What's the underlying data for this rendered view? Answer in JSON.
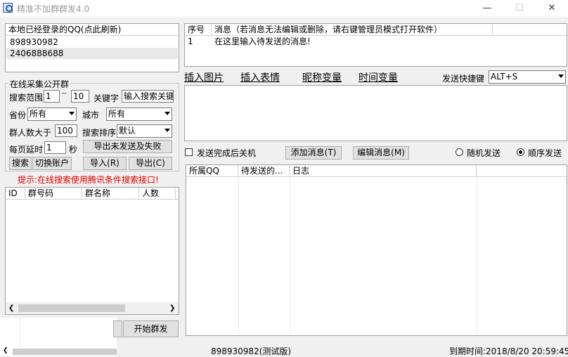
{
  "window": {
    "title": "精准不加群群发4.0",
    "minimize": "—",
    "maximize": "☐",
    "close": "✕"
  },
  "qq_list": {
    "header": "本地已经登录的QQ(点此刷新)",
    "items": [
      "898930982",
      "2406888688"
    ]
  },
  "collect": {
    "group_title": "在线采集公开群",
    "range_label": "搜索范围",
    "range_from": "1",
    "range_sep": "--",
    "range_to": "10",
    "keyword_label": "关键字",
    "keyword_placeholder": "输入搜索关键",
    "province_label": "省份",
    "province_value": "所有",
    "city_label": "城市",
    "city_value": "所有",
    "members_label": "群人数大于",
    "members_value": "100",
    "sort_label": "搜索排序",
    "sort_value": "默认",
    "delay_label": "每页延时",
    "delay_value": "1",
    "delay_unit": "秒",
    "export_unsent_btn": "导出未发送及失败",
    "search_btn": "搜索",
    "switch_btn": "切换账户",
    "import_btn": "导入(R)",
    "export_btn": "导出(C)",
    "hint": "提示:在线搜索使用腾讯条件搜索接口!"
  },
  "group_table": {
    "columns": [
      "ID",
      "群号码",
      "群名称",
      "人数"
    ]
  },
  "bottom_left": {
    "start_btn": "开始群发"
  },
  "messages": {
    "columns": [
      "序号",
      "消息（若消息无法编辑或删除，请右键管理员模式打开软件）"
    ],
    "rows": [
      {
        "no": "1",
        "text": "在这里输入待发送的消息!"
      }
    ]
  },
  "toolbar": {
    "insert_image": "插入图片",
    "insert_emoji": "插入表情",
    "nick_var": "昵称变量",
    "time_var": "时间变量",
    "hotkey_label": "发送快捷键",
    "hotkey_value": "ALT+S"
  },
  "options": {
    "shutdown_label": "发送完成后关机",
    "add_btn": "添加消息(T)",
    "edit_btn": "编辑消息(M)",
    "random_label": "随机发送",
    "sequential_label": "顺序发送"
  },
  "log_table": {
    "columns": [
      "所属QQ",
      "待发送的...",
      "日志"
    ]
  },
  "status": {
    "account": "898930982(测试版)",
    "expiry": "到期时间:2018/8/20 20:59:45"
  },
  "colors": {
    "hint": "#e00000",
    "selected_row": "#e8e8e8"
  }
}
